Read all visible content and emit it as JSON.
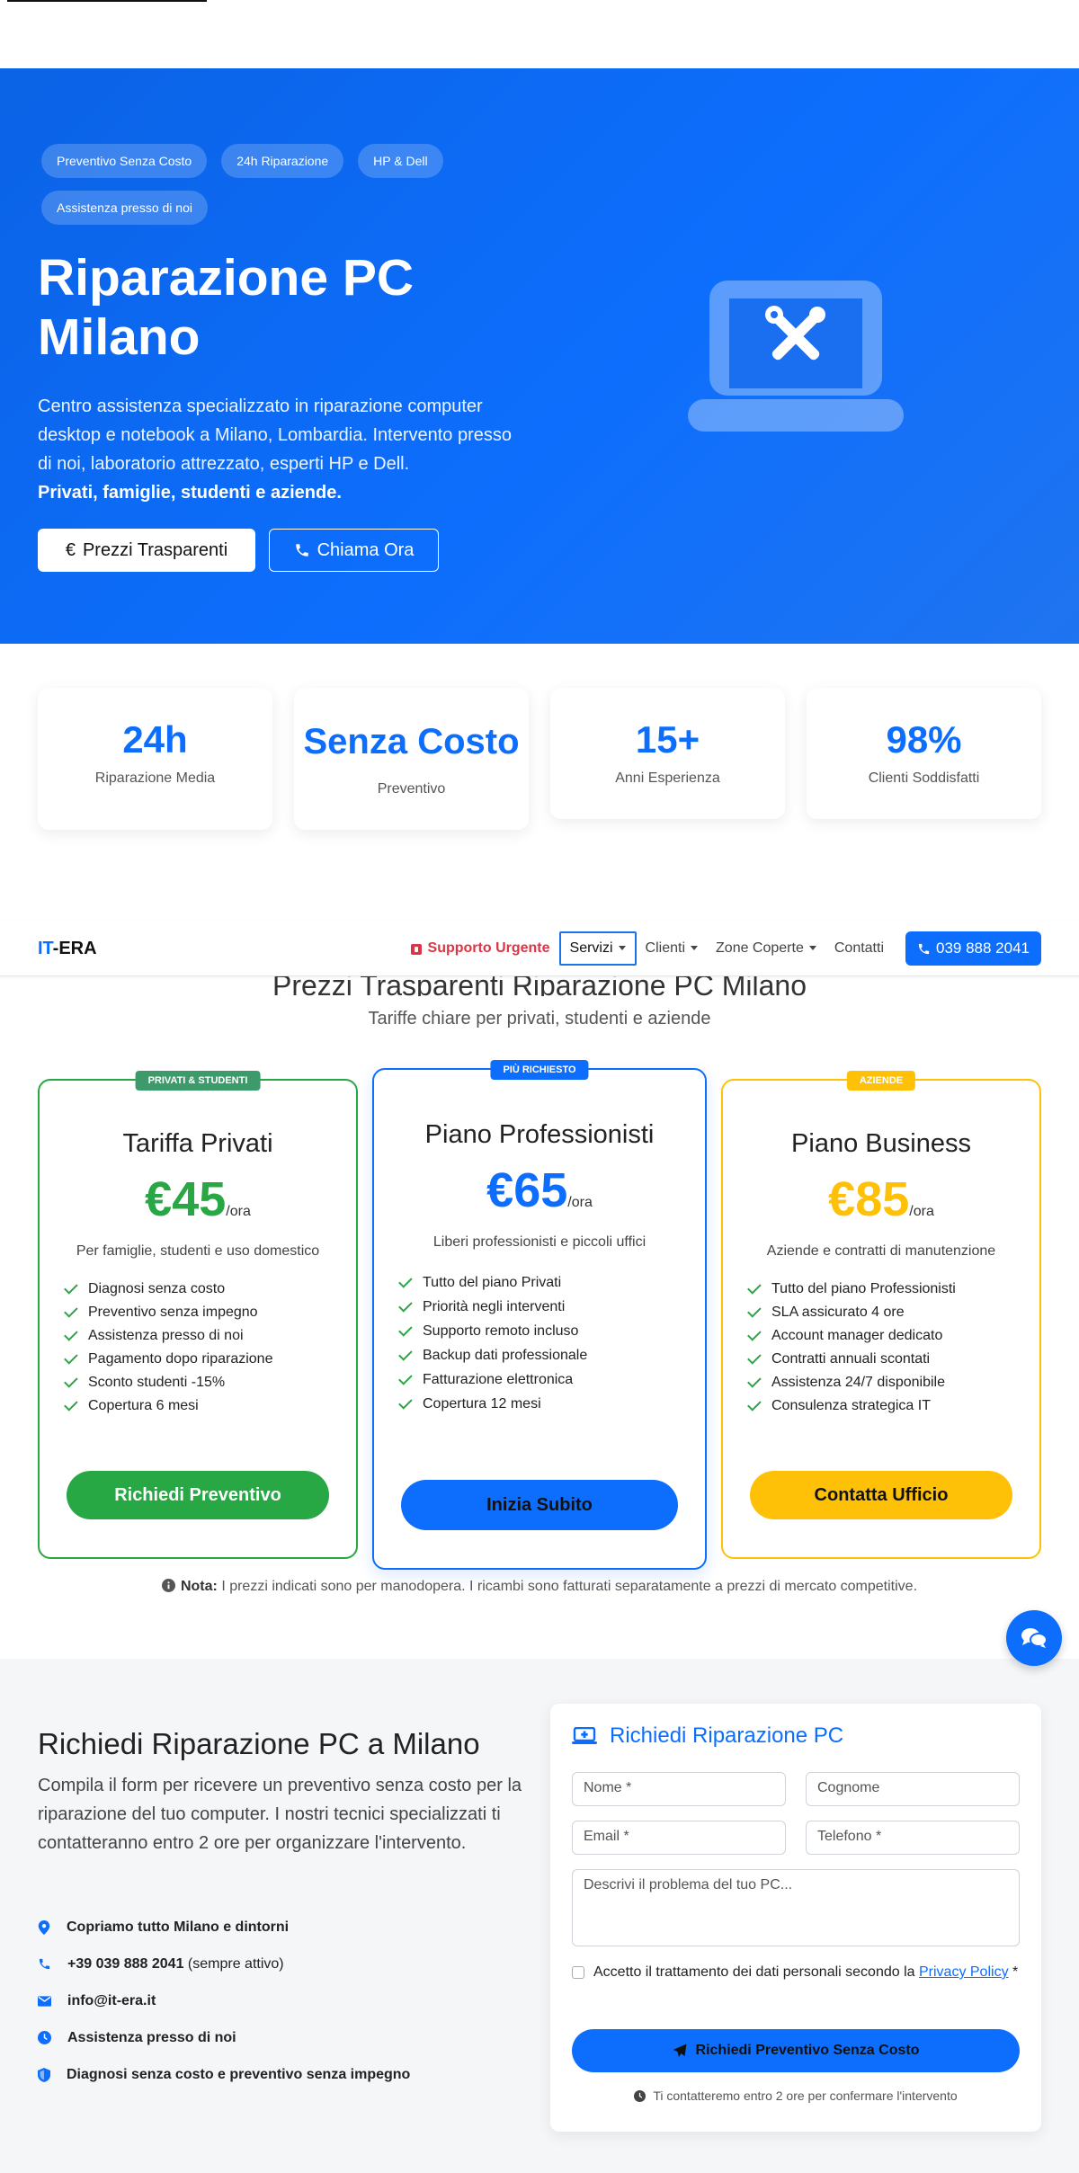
{
  "hero": {
    "badges": [
      "Preventivo Senza Costo",
      "24h Riparazione",
      "HP & Dell",
      "Assistenza presso di noi"
    ],
    "title": "Riparazione PC Milano",
    "lead": "Centro assistenza specializzato in riparazione computer desktop e notebook a Milano, Lombardia. Intervento presso di noi, laboratorio attrezzato, esperti HP e Dell.",
    "lead_bold": "Privati, famiglie, studenti e aziende.",
    "btn_prices": "Prezzi Trasparenti",
    "btn_prices_symbol": "€",
    "btn_call": "Chiama Ora"
  },
  "stats": [
    {
      "value": "24h",
      "label": "Riparazione Media"
    },
    {
      "value": "Senza Costo",
      "label": "Preventivo"
    },
    {
      "value": "15+",
      "label": "Anni Esperienza"
    },
    {
      "value": "98%",
      "label": "Clienti Soddisfatti"
    }
  ],
  "nav": {
    "logo_a": "IT",
    "logo_b": "-ERA",
    "urgent": "Supporto Urgente",
    "servizi": "Servizi",
    "clienti": "Clienti",
    "zone": "Zone Coperte",
    "contatti": "Contatti",
    "phone": "039 888 2041"
  },
  "pricing": {
    "title": "Prezzi Trasparenti Riparazione PC Milano",
    "subtitle": "Tariffe chiare per privati, studenti e aziende",
    "unit": "/ora",
    "plans": [
      {
        "tag": "PRIVATI & STUDENTI",
        "name": "Tariffa Privati",
        "price": "€45",
        "desc": "Per famiglie, studenti e uso domestico",
        "features": [
          "Diagnosi senza costo",
          "Preventivo senza impegno",
          "Assistenza presso di noi",
          "Pagamento dopo riparazione",
          "Sconto studenti -15%",
          "Copertura 6 mesi"
        ],
        "cta": "Richiedi Preventivo"
      },
      {
        "tag": "PIÙ RICHIESTO",
        "name": "Piano Professionisti",
        "price": "€65",
        "desc": "Liberi professionisti e piccoli uffici",
        "features": [
          "Tutto del piano Privati",
          "Priorità negli interventi",
          "Supporto remoto incluso",
          "Backup dati professionale",
          "Fatturazione elettronica",
          "Copertura 12 mesi"
        ],
        "cta": "Inizia Subito"
      },
      {
        "tag": "AZIENDE",
        "name": "Piano Business",
        "price": "€85",
        "desc": "Aziende e contratti di manutenzione",
        "features": [
          "Tutto del piano Professionisti",
          "SLA assicurato 4 ore",
          "Account manager dedicato",
          "Contratti annuali scontati",
          "Assistenza 24/7 disponibile",
          "Consulenza strategica IT"
        ],
        "cta": "Contatta Ufficio"
      }
    ],
    "note_bold": "Nota:",
    "note": "I prezzi indicati sono per manodopera. I ricambi sono fatturati separatamente a prezzi di mercato competitive."
  },
  "contact": {
    "title": "Richiedi Riparazione PC a Milano",
    "text": "Compila il form per ricevere un preventivo senza costo per la riparazione del tuo computer. I nostri tecnici specializzati ti contatteranno entro 2 ore per organizzare l'intervento.",
    "items": [
      {
        "bold": "Copriamo tutto Milano e dintorni",
        "rest": ""
      },
      {
        "bold": "+39 039 888 2041",
        "rest": " (sempre attivo)"
      },
      {
        "bold": "info@it-era.it",
        "rest": ""
      },
      {
        "bold": "Assistenza presso di noi",
        "rest": ""
      },
      {
        "bold": "Diagnosi senza costo e preventivo senza impegno",
        "rest": ""
      }
    ],
    "form": {
      "title": "Richiedi Riparazione PC",
      "nome": "Nome *",
      "cognome": "Cognome",
      "email": "Email *",
      "telefono": "Telefono *",
      "problema": "Descrivi il problema del tuo PC...",
      "privacy_a": "Accetto il trattamento dei dati personali secondo la ",
      "privacy_link": "Privacy Policy",
      "privacy_b": " *",
      "submit": "Richiedi Preventivo Senza Costo",
      "note": "Ti contatteremo entro 2 ore per confermare l'intervento"
    }
  },
  "colors": {
    "primary": "#0d6efd",
    "green": "#28a745",
    "yellow": "#ffc107",
    "red": "#dc3545"
  }
}
